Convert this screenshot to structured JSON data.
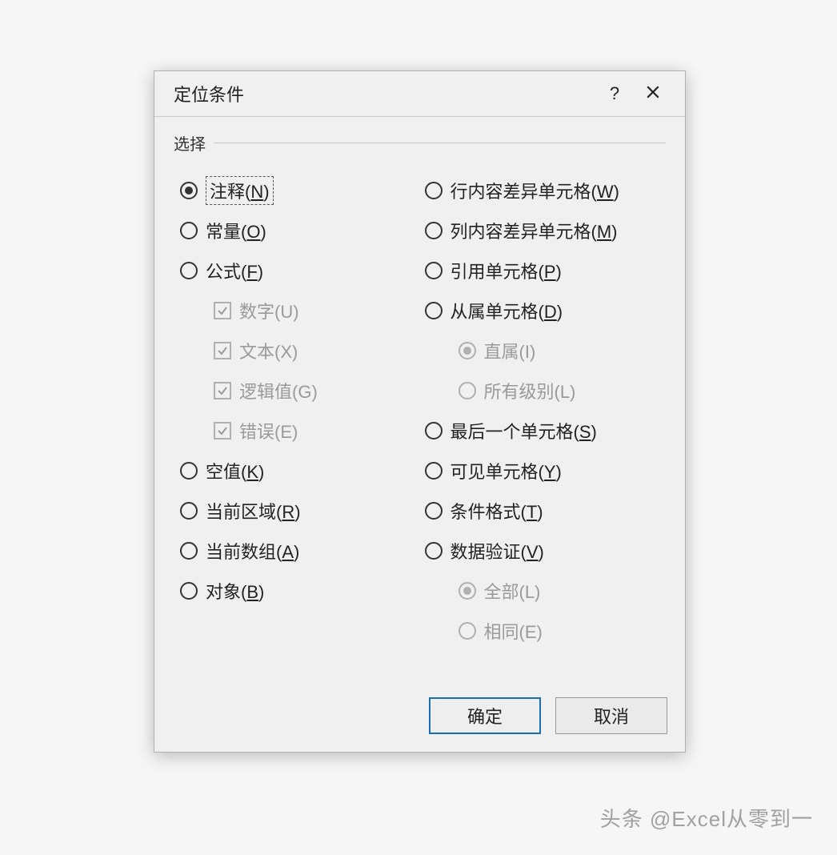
{
  "dialog": {
    "title": "定位条件",
    "help": "?",
    "section_label": "选择",
    "left": {
      "comments": {
        "text": "注释",
        "accel": "N",
        "checked": true
      },
      "constants": {
        "text": "常量",
        "accel": "O"
      },
      "formulas": {
        "text": "公式",
        "accel": "F"
      },
      "formula_opts": {
        "numbers": "数字(U)",
        "text": "文本(X)",
        "logicals": "逻辑值(G)",
        "errors": "错误(E)"
      },
      "blanks": {
        "text": "空值",
        "accel": "K"
      },
      "current_region": {
        "text": "当前区域",
        "accel": "R"
      },
      "current_array": {
        "text": "当前数组",
        "accel": "A"
      },
      "objects": {
        "text": "对象",
        "accel": "B"
      }
    },
    "right": {
      "row_diff": {
        "text": "行内容差异单元格",
        "accel": "W"
      },
      "col_diff": {
        "text": "列内容差异单元格",
        "accel": "M"
      },
      "precedents": {
        "text": "引用单元格",
        "accel": "P"
      },
      "dependents": {
        "text": "从属单元格",
        "accel": "D"
      },
      "dep_opts": {
        "direct": "直属(I)",
        "all": "所有级别(L)"
      },
      "last_cell": {
        "text": "最后一个单元格",
        "accel": "S"
      },
      "visible": {
        "text": "可见单元格",
        "accel": "Y"
      },
      "cond_format": {
        "text": "条件格式",
        "accel": "T"
      },
      "data_valid": {
        "text": "数据验证",
        "accel": "V"
      },
      "dv_opts": {
        "all": "全部(L)",
        "same": "相同(E)"
      }
    },
    "buttons": {
      "ok": "确定",
      "cancel": "取消"
    }
  },
  "watermark": "头条 @Excel从零到一"
}
